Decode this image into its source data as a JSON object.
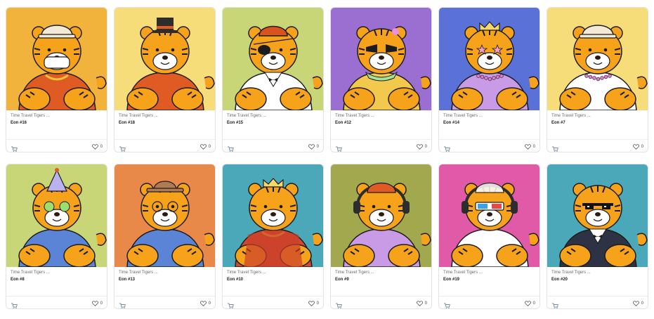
{
  "cards": [
    {
      "title": "Time Travel Tigers ...",
      "name": "Eon #16",
      "likes": "0",
      "bg": "#f2b33d",
      "shirt": "#e05a24",
      "accessory": "cap-mask-chain"
    },
    {
      "title": "Time Travel Tigers ...",
      "name": "Eon #18",
      "likes": "0",
      "bg": "#f7dd7a",
      "shirt": "#e05a24",
      "accessory": "top-hat"
    },
    {
      "title": "Time Travel Tigers ...",
      "name": "Eon #15",
      "likes": "0",
      "bg": "#c9d678",
      "shirt": "#ffffff",
      "accessory": "beanie-eyepatch-tux"
    },
    {
      "title": "Time Travel Tigers ...",
      "name": "Eon #12",
      "likes": "0",
      "bg": "#9b6fd1",
      "shirt": "#f2c94c",
      "accessory": "flower-sunglasses-scarf"
    },
    {
      "title": "Time Travel Tigers ...",
      "name": "Eon #14",
      "likes": "0",
      "bg": "#5a72d8",
      "shirt": "#c99ae6",
      "accessory": "crown-star-glasses"
    },
    {
      "title": "Time Travel Tigers ...",
      "name": "Eon #7",
      "likes": "0",
      "bg": "#f7dd7a",
      "shirt": "#ffffff",
      "accessory": "cap-necklace"
    },
    {
      "title": "Time Travel Tigers ...",
      "name": "Eon #8",
      "likes": "0",
      "bg": "#c9d678",
      "shirt": "#5b84d6",
      "accessory": "party-hat-green-glasses"
    },
    {
      "title": "Time Travel Tigers ...",
      "name": "Eon #13",
      "likes": "0",
      "bg": "#e8894a",
      "shirt": "#5b84d6",
      "accessory": "fedora-round-glasses"
    },
    {
      "title": "Time Travel Tigers ...",
      "name": "Eon #10",
      "likes": "0",
      "bg": "#4aa8b8",
      "shirt": "#d24a2c",
      "accessory": "crown-cape-chain"
    },
    {
      "title": "Time Travel Tigers ...",
      "name": "Eon #9",
      "likes": "0",
      "bg": "#a2a84e",
      "shirt": "#c99ae6",
      "accessory": "headphones-cap"
    },
    {
      "title": "Time Travel Tigers ...",
      "name": "Eon #19",
      "likes": "0",
      "bg": "#e05aa8",
      "shirt": "#ffffff",
      "accessory": "3d-glasses-headphones"
    },
    {
      "title": "Time Travel Tigers ...",
      "name": "Eon #20",
      "likes": "0",
      "bg": "#4aa8b8",
      "shirt": "#2d3244",
      "accessory": "pixel-sunglasses-suit"
    }
  ],
  "colors": {
    "tiger": "#f7a21b",
    "stripe": "#1c1c1c",
    "muzzle": "#ffffff",
    "nose": "#2a1a12"
  }
}
